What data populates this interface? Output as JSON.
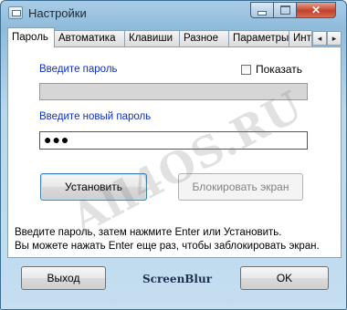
{
  "window": {
    "title": "Настройки"
  },
  "tabs": [
    {
      "label": "Пароль",
      "active": true
    },
    {
      "label": "Автоматика"
    },
    {
      "label": "Клавиши"
    },
    {
      "label": "Разное"
    },
    {
      "label": "Параметры"
    },
    {
      "label": "Инте"
    }
  ],
  "tab_scroll": {
    "left": "◂",
    "right": "▸"
  },
  "password": {
    "current_label": "Введите пароль",
    "new_label": "Введите новый пароль",
    "new_value": "●●●",
    "show_label": "Показать",
    "show_checked": false
  },
  "buttons": {
    "set": "Установить",
    "lock": "Блокировать экран",
    "exit": "Выход",
    "ok": "OK"
  },
  "help": {
    "line1": "Введите пароль, затем нажмите Enter или Установить.",
    "line2": "Вы можете нажать Enter еще раз, чтобы заблокировать экран."
  },
  "brand": "ScreenBlur",
  "watermark": "All4OS.RU"
}
